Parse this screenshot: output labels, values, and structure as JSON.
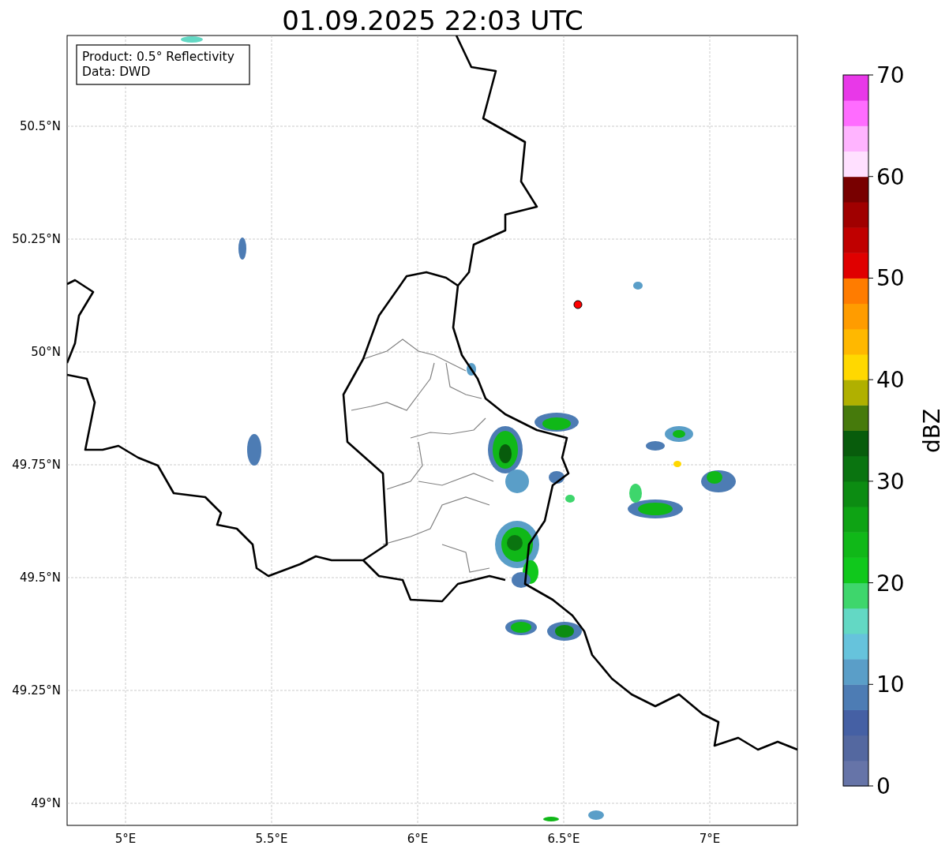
{
  "title": "01.09.2025 22:03 UTC",
  "info_box": [
    "Product: 0.5° Reflectivity",
    "Data: DWD"
  ],
  "x_ticks": [
    "5°E",
    "5.5°E",
    "6°E",
    "6.5°E",
    "7°E"
  ],
  "y_ticks": [
    "50.5°N",
    "50.25°N",
    "50°N",
    "49.75°N",
    "49.5°N",
    "49.25°N",
    "49°N"
  ],
  "colorbar": {
    "label": "dBZ",
    "ticks": [
      "70",
      "60",
      "50",
      "40",
      "30",
      "20",
      "10",
      "0"
    ]
  }
}
